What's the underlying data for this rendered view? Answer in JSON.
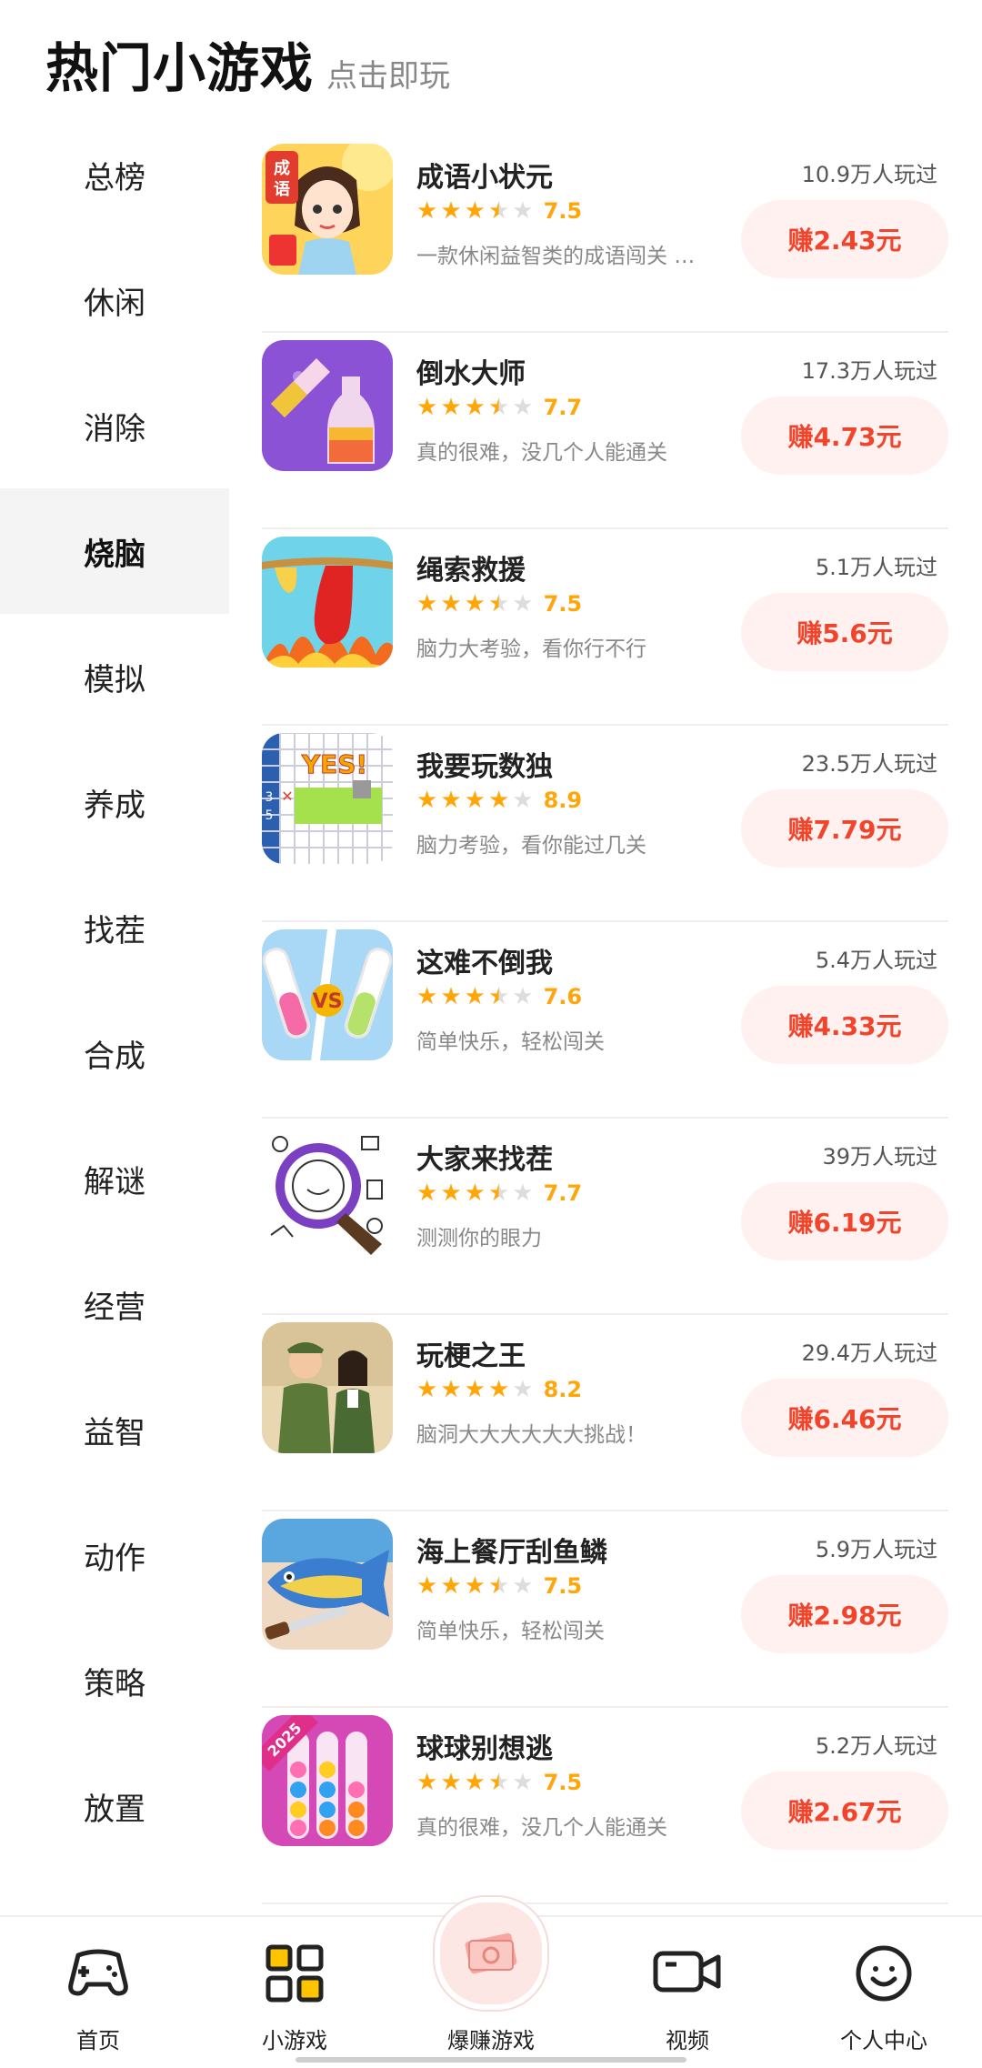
{
  "header": {
    "title": "热门小游戏",
    "subtitle": "点击即玩"
  },
  "sidebar": {
    "active_index": 3,
    "items": [
      "总榜",
      "休闲",
      "消除",
      "烧脑",
      "模拟",
      "养成",
      "找茬",
      "合成",
      "解谜",
      "经营",
      "益智",
      "动作",
      "策略",
      "放置"
    ]
  },
  "games": [
    {
      "name": "成语小状元",
      "rating": "7.5",
      "stars": 3.5,
      "desc": "一款休闲益智类的成语闯关 …",
      "plays": "10.9万人玩过",
      "earn": "赚2.43元",
      "icon": "idiom-game-icon"
    },
    {
      "name": "倒水大师",
      "rating": "7.7",
      "stars": 3.5,
      "desc": "真的很难，没几个人能通关",
      "plays": "17.3万人玩过",
      "earn": "赚4.73元",
      "icon": "pour-water-game-icon"
    },
    {
      "name": "绳索救援",
      "rating": "7.5",
      "stars": 3.5,
      "desc": "脑力大考验，看你行不行",
      "plays": "5.1万人玩过",
      "earn": "赚5.6元",
      "icon": "rope-rescue-game-icon"
    },
    {
      "name": "我要玩数独",
      "rating": "8.9",
      "stars": 4,
      "desc": "脑力考验，看你能过几关",
      "plays": "23.5万人玩过",
      "earn": "赚7.79元",
      "icon": "sudoku-game-icon"
    },
    {
      "name": "这难不倒我",
      "rating": "7.6",
      "stars": 3.5,
      "desc": "简单快乐，轻松闯关",
      "plays": "5.4万人玩过",
      "earn": "赚4.33元",
      "icon": "tube-vs-game-icon"
    },
    {
      "name": "大家来找茬",
      "rating": "7.7",
      "stars": 3.5,
      "desc": "测测你的眼力",
      "plays": "39万人玩过",
      "earn": "赚6.19元",
      "icon": "magnifier-game-icon"
    },
    {
      "name": "玩梗之王",
      "rating": "8.2",
      "stars": 4,
      "desc": "脑洞大大大大大大挑战！",
      "plays": "29.4万人玩过",
      "earn": "赚6.46元",
      "icon": "meme-king-game-icon"
    },
    {
      "name": "海上餐厅刮鱼鳞",
      "rating": "7.5",
      "stars": 3.5,
      "desc": "简单快乐，轻松闯关",
      "plays": "5.9万人玩过",
      "earn": "赚2.98元",
      "icon": "fish-scale-game-icon"
    },
    {
      "name": "球球别想逃",
      "rating": "7.5",
      "stars": 3.5,
      "desc": "真的很难，没几个人能通关",
      "plays": "5.2万人玩过",
      "earn": "赚2.67元",
      "icon": "ball-sort-game-icon"
    }
  ],
  "thumbnail_texts": {
    "idiom": "成语",
    "sudoku": "YES!",
    "vs": "VS",
    "year": "2025"
  },
  "tabbar": {
    "items": [
      {
        "label": "首页",
        "icon": "gamepad-icon"
      },
      {
        "label": "小游戏",
        "icon": "grid-icon"
      },
      {
        "label": "爆赚游戏",
        "icon": "money-icon"
      },
      {
        "label": "视频",
        "icon": "video-camera-icon"
      },
      {
        "label": "个人中心",
        "icon": "smile-face-icon"
      }
    ]
  },
  "colors": {
    "accent": "#f1442b",
    "star": "#ffa60a",
    "earn_bg": "#fff1ef"
  }
}
